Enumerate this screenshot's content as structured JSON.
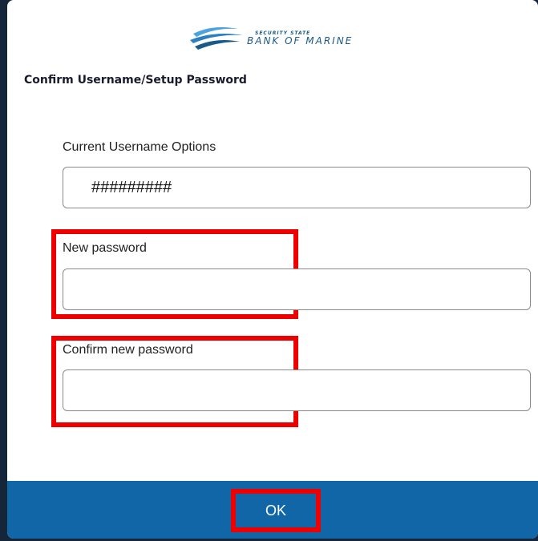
{
  "brand": {
    "small_text": "SECURITY STATE",
    "name": "BANK OF MARINE",
    "colors": {
      "primary": "#1166a8",
      "wave_light": "#4aa3df",
      "wave_dark": "#1a5a8a"
    }
  },
  "dialog": {
    "title": "Confirm Username/Setup Password"
  },
  "fields": {
    "username": {
      "label": "Current Username Options",
      "value": "#########"
    },
    "new_password": {
      "label": "New password",
      "value": ""
    },
    "confirm_password": {
      "label": "Confirm new password",
      "value": ""
    }
  },
  "footer": {
    "ok_label": "OK"
  },
  "highlight_color": "#ee0000"
}
